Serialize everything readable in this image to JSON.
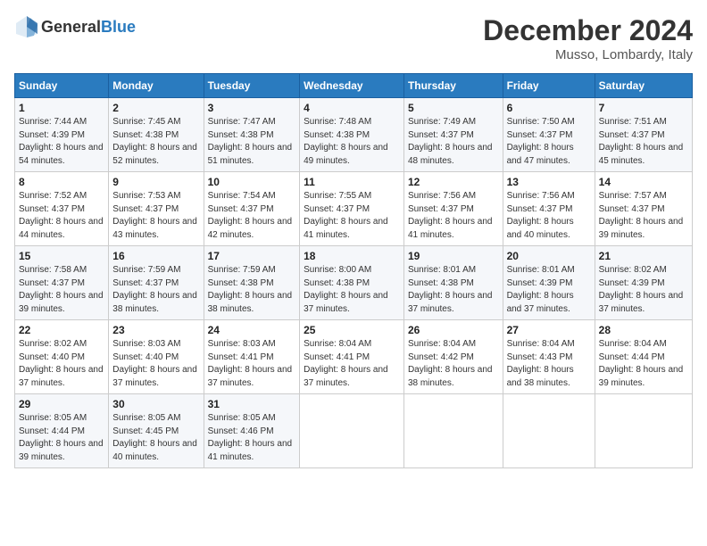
{
  "header": {
    "logo_general": "General",
    "logo_blue": "Blue",
    "month_title": "December 2024",
    "location": "Musso, Lombardy, Italy"
  },
  "columns": [
    "Sunday",
    "Monday",
    "Tuesday",
    "Wednesday",
    "Thursday",
    "Friday",
    "Saturday"
  ],
  "weeks": [
    [
      {
        "day": "1",
        "sunrise": "Sunrise: 7:44 AM",
        "sunset": "Sunset: 4:39 PM",
        "daylight": "Daylight: 8 hours and 54 minutes."
      },
      {
        "day": "2",
        "sunrise": "Sunrise: 7:45 AM",
        "sunset": "Sunset: 4:38 PM",
        "daylight": "Daylight: 8 hours and 52 minutes."
      },
      {
        "day": "3",
        "sunrise": "Sunrise: 7:47 AM",
        "sunset": "Sunset: 4:38 PM",
        "daylight": "Daylight: 8 hours and 51 minutes."
      },
      {
        "day": "4",
        "sunrise": "Sunrise: 7:48 AM",
        "sunset": "Sunset: 4:38 PM",
        "daylight": "Daylight: 8 hours and 49 minutes."
      },
      {
        "day": "5",
        "sunrise": "Sunrise: 7:49 AM",
        "sunset": "Sunset: 4:37 PM",
        "daylight": "Daylight: 8 hours and 48 minutes."
      },
      {
        "day": "6",
        "sunrise": "Sunrise: 7:50 AM",
        "sunset": "Sunset: 4:37 PM",
        "daylight": "Daylight: 8 hours and 47 minutes."
      },
      {
        "day": "7",
        "sunrise": "Sunrise: 7:51 AM",
        "sunset": "Sunset: 4:37 PM",
        "daylight": "Daylight: 8 hours and 45 minutes."
      }
    ],
    [
      {
        "day": "8",
        "sunrise": "Sunrise: 7:52 AM",
        "sunset": "Sunset: 4:37 PM",
        "daylight": "Daylight: 8 hours and 44 minutes."
      },
      {
        "day": "9",
        "sunrise": "Sunrise: 7:53 AM",
        "sunset": "Sunset: 4:37 PM",
        "daylight": "Daylight: 8 hours and 43 minutes."
      },
      {
        "day": "10",
        "sunrise": "Sunrise: 7:54 AM",
        "sunset": "Sunset: 4:37 PM",
        "daylight": "Daylight: 8 hours and 42 minutes."
      },
      {
        "day": "11",
        "sunrise": "Sunrise: 7:55 AM",
        "sunset": "Sunset: 4:37 PM",
        "daylight": "Daylight: 8 hours and 41 minutes."
      },
      {
        "day": "12",
        "sunrise": "Sunrise: 7:56 AM",
        "sunset": "Sunset: 4:37 PM",
        "daylight": "Daylight: 8 hours and 41 minutes."
      },
      {
        "day": "13",
        "sunrise": "Sunrise: 7:56 AM",
        "sunset": "Sunset: 4:37 PM",
        "daylight": "Daylight: 8 hours and 40 minutes."
      },
      {
        "day": "14",
        "sunrise": "Sunrise: 7:57 AM",
        "sunset": "Sunset: 4:37 PM",
        "daylight": "Daylight: 8 hours and 39 minutes."
      }
    ],
    [
      {
        "day": "15",
        "sunrise": "Sunrise: 7:58 AM",
        "sunset": "Sunset: 4:37 PM",
        "daylight": "Daylight: 8 hours and 39 minutes."
      },
      {
        "day": "16",
        "sunrise": "Sunrise: 7:59 AM",
        "sunset": "Sunset: 4:37 PM",
        "daylight": "Daylight: 8 hours and 38 minutes."
      },
      {
        "day": "17",
        "sunrise": "Sunrise: 7:59 AM",
        "sunset": "Sunset: 4:38 PM",
        "daylight": "Daylight: 8 hours and 38 minutes."
      },
      {
        "day": "18",
        "sunrise": "Sunrise: 8:00 AM",
        "sunset": "Sunset: 4:38 PM",
        "daylight": "Daylight: 8 hours and 37 minutes."
      },
      {
        "day": "19",
        "sunrise": "Sunrise: 8:01 AM",
        "sunset": "Sunset: 4:38 PM",
        "daylight": "Daylight: 8 hours and 37 minutes."
      },
      {
        "day": "20",
        "sunrise": "Sunrise: 8:01 AM",
        "sunset": "Sunset: 4:39 PM",
        "daylight": "Daylight: 8 hours and 37 minutes."
      },
      {
        "day": "21",
        "sunrise": "Sunrise: 8:02 AM",
        "sunset": "Sunset: 4:39 PM",
        "daylight": "Daylight: 8 hours and 37 minutes."
      }
    ],
    [
      {
        "day": "22",
        "sunrise": "Sunrise: 8:02 AM",
        "sunset": "Sunset: 4:40 PM",
        "daylight": "Daylight: 8 hours and 37 minutes."
      },
      {
        "day": "23",
        "sunrise": "Sunrise: 8:03 AM",
        "sunset": "Sunset: 4:40 PM",
        "daylight": "Daylight: 8 hours and 37 minutes."
      },
      {
        "day": "24",
        "sunrise": "Sunrise: 8:03 AM",
        "sunset": "Sunset: 4:41 PM",
        "daylight": "Daylight: 8 hours and 37 minutes."
      },
      {
        "day": "25",
        "sunrise": "Sunrise: 8:04 AM",
        "sunset": "Sunset: 4:41 PM",
        "daylight": "Daylight: 8 hours and 37 minutes."
      },
      {
        "day": "26",
        "sunrise": "Sunrise: 8:04 AM",
        "sunset": "Sunset: 4:42 PM",
        "daylight": "Daylight: 8 hours and 38 minutes."
      },
      {
        "day": "27",
        "sunrise": "Sunrise: 8:04 AM",
        "sunset": "Sunset: 4:43 PM",
        "daylight": "Daylight: 8 hours and 38 minutes."
      },
      {
        "day": "28",
        "sunrise": "Sunrise: 8:04 AM",
        "sunset": "Sunset: 4:44 PM",
        "daylight": "Daylight: 8 hours and 39 minutes."
      }
    ],
    [
      {
        "day": "29",
        "sunrise": "Sunrise: 8:05 AM",
        "sunset": "Sunset: 4:44 PM",
        "daylight": "Daylight: 8 hours and 39 minutes."
      },
      {
        "day": "30",
        "sunrise": "Sunrise: 8:05 AM",
        "sunset": "Sunset: 4:45 PM",
        "daylight": "Daylight: 8 hours and 40 minutes."
      },
      {
        "day": "31",
        "sunrise": "Sunrise: 8:05 AM",
        "sunset": "Sunset: 4:46 PM",
        "daylight": "Daylight: 8 hours and 41 minutes."
      },
      null,
      null,
      null,
      null
    ]
  ]
}
